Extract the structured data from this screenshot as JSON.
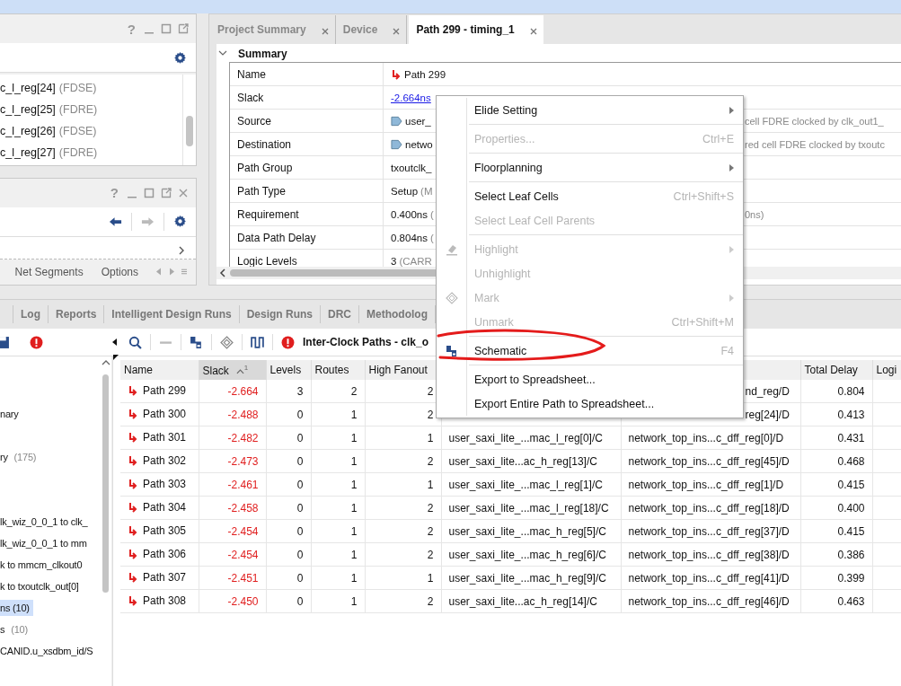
{
  "cells_panel": {
    "help": "?",
    "items": [
      {
        "name": "c_l_reg[24]",
        "type": "(FDSE)"
      },
      {
        "name": "c_l_reg[25]",
        "type": "(FDRE)"
      },
      {
        "name": "c_l_reg[26]",
        "type": "(FDSE)"
      },
      {
        "name": "c_l_reg[27]",
        "type": "(FDRE)"
      }
    ]
  },
  "nets_panel": {
    "help": "?",
    "tabs": [
      "Net Segments",
      "Options"
    ]
  },
  "editor_tabs": [
    {
      "label": "Project Summary",
      "selected": false
    },
    {
      "label": "Device",
      "selected": false
    },
    {
      "label": "Path 299 - timing_1",
      "selected": true
    }
  ],
  "summary": {
    "title": "Summary",
    "expanded": true,
    "rows": [
      {
        "label": "Name",
        "kind": "path",
        "value": "Path 299"
      },
      {
        "label": "Slack",
        "kind": "link",
        "value": "-2.664ns"
      },
      {
        "label": "Source",
        "kind": "port",
        "value": "user_",
        "tail": "cell FDRE clocked by clk_out1_"
      },
      {
        "label": "Destination",
        "kind": "port",
        "value": "netwo",
        "tail": "red cell FDRE clocked by txoutc"
      },
      {
        "label": "Path Group",
        "kind": "text",
        "value": "txoutclk_"
      },
      {
        "label": "Path Type",
        "kind": "text",
        "value": "Setup",
        "note": "(M"
      },
      {
        "label": "Requirement",
        "kind": "text",
        "value": "0.400ns",
        "note": "(",
        "tail": "0ns)"
      },
      {
        "label": "Data Path Delay",
        "kind": "text",
        "value": "0.804ns",
        "note": "("
      },
      {
        "label": "Logic Levels",
        "kind": "text",
        "value": "3",
        "note": "(CARR"
      }
    ]
  },
  "bottom_tabs": [
    "Log",
    "Reports",
    "Intelligent Design Runs",
    "Design Runs",
    "DRC",
    "Methodolog"
  ],
  "paths_toolbar": {
    "title": "Inter-Clock Paths - clk_o"
  },
  "tree": {
    "items": [
      {
        "text": "nary",
        "selected": false
      },
      {
        "text": "ry",
        "count": "(175)",
        "selected": false
      },
      {
        "text": "lk_wiz_0_0_1 to clk_",
        "selected": false
      },
      {
        "text": "lk_wiz_0_0_1 to mm",
        "selected": false
      },
      {
        "text": "k to mmcm_clkout0",
        "selected": false
      },
      {
        "text": "k to txoutclk_out[0]",
        "selected": false
      },
      {
        "text": "ns (10)",
        "selected": true
      },
      {
        "text": "s",
        "count": "(10)",
        "selected": false
      },
      {
        "text": "CANID.u_xsdbm_id/S",
        "selected": false
      }
    ]
  },
  "table": {
    "columns": [
      {
        "label": "Name",
        "sorted": false
      },
      {
        "label": "Slack",
        "sorted": true,
        "sort_order": "1"
      },
      {
        "label": "Levels",
        "sorted": false
      },
      {
        "label": "Routes",
        "sorted": false
      },
      {
        "label": "High Fanout",
        "sorted": false
      },
      {
        "label": "Total Delay",
        "sorted": false
      },
      {
        "label": "Logi",
        "sorted": false
      }
    ],
    "rows": [
      {
        "name": "Path 299",
        "slack": "-2.664",
        "levels": "3",
        "routes": "2",
        "fanout": "2",
        "to": "nd_reg/D",
        "delay": "0.804",
        "clipped": true
      },
      {
        "name": "Path 300",
        "slack": "-2.488",
        "levels": "0",
        "routes": "1",
        "fanout": "2",
        "to": "reg[24]/D",
        "delay": "0.413",
        "clipped": true
      },
      {
        "name": "Path 301",
        "slack": "-2.482",
        "levels": "0",
        "routes": "1",
        "fanout": "1",
        "from": "user_saxi_lite_...mac_l_reg[0]/C",
        "to": "network_top_ins...c_dff_reg[0]/D",
        "delay": "0.431",
        "clipped": false
      },
      {
        "name": "Path 302",
        "slack": "-2.473",
        "levels": "0",
        "routes": "1",
        "fanout": "2",
        "from": "user_saxi_lite...ac_h_reg[13]/C",
        "to": "network_top_ins...c_dff_reg[45]/D",
        "delay": "0.468",
        "clipped": false
      },
      {
        "name": "Path 303",
        "slack": "-2.461",
        "levels": "0",
        "routes": "1",
        "fanout": "1",
        "from": "user_saxi_lite_...mac_l_reg[1]/C",
        "to": "network_top_ins...c_dff_reg[1]/D",
        "delay": "0.415",
        "clipped": false
      },
      {
        "name": "Path 304",
        "slack": "-2.458",
        "levels": "0",
        "routes": "1",
        "fanout": "2",
        "from": "user_saxi_lite_...mac_l_reg[18]/C",
        "to": "network_top_ins...c_dff_reg[18]/D",
        "delay": "0.400",
        "clipped": false
      },
      {
        "name": "Path 305",
        "slack": "-2.454",
        "levels": "0",
        "routes": "1",
        "fanout": "2",
        "from": "user_saxi_lite_...mac_h_reg[5]/C",
        "to": "network_top_ins...c_dff_reg[37]/D",
        "delay": "0.415",
        "clipped": false
      },
      {
        "name": "Path 306",
        "slack": "-2.454",
        "levels": "0",
        "routes": "1",
        "fanout": "2",
        "from": "user_saxi_lite_...mac_h_reg[6]/C",
        "to": "network_top_ins...c_dff_reg[38]/D",
        "delay": "0.386",
        "clipped": false
      },
      {
        "name": "Path 307",
        "slack": "-2.451",
        "levels": "0",
        "routes": "1",
        "fanout": "1",
        "from": "user_saxi_lite_...mac_h_reg[9]/C",
        "to": "network_top_ins...c_dff_reg[41]/D",
        "delay": "0.399",
        "clipped": false
      },
      {
        "name": "Path 308",
        "slack": "-2.450",
        "levels": "0",
        "routes": "1",
        "fanout": "2",
        "from": "user_saxi_lite...ac_h_reg[14]/C",
        "to": "network_top_ins...c_dff_reg[46]/D",
        "delay": "0.463",
        "clipped": false
      }
    ]
  },
  "context_menu": {
    "items": [
      {
        "kind": "item",
        "label": "Elide Setting",
        "disabled": false,
        "submenu": true
      },
      {
        "kind": "separator"
      },
      {
        "kind": "item",
        "label": "Properties...",
        "shortcut": "Ctrl+E",
        "disabled": true,
        "submenu": false
      },
      {
        "kind": "separator"
      },
      {
        "kind": "item",
        "label": "Floorplanning",
        "disabled": false,
        "submenu": true
      },
      {
        "kind": "separator"
      },
      {
        "kind": "item",
        "label": "Select Leaf Cells",
        "shortcut": "Ctrl+Shift+S",
        "disabled": false,
        "submenu": false
      },
      {
        "kind": "item",
        "label": "Select Leaf Cell Parents",
        "disabled": true,
        "submenu": false
      },
      {
        "kind": "separator"
      },
      {
        "kind": "item",
        "label": "Highlight",
        "disabled": true,
        "submenu": true
      },
      {
        "kind": "item",
        "label": "Unhighlight",
        "disabled": true,
        "submenu": false
      },
      {
        "kind": "item",
        "label": "Mark",
        "disabled": true,
        "submenu": true
      },
      {
        "kind": "item",
        "label": "Unmark",
        "shortcut": "Ctrl+Shift+M",
        "disabled": true,
        "submenu": false
      },
      {
        "kind": "separator"
      },
      {
        "kind": "item",
        "label": "Schematic",
        "shortcut": "F4",
        "disabled": false,
        "submenu": false
      },
      {
        "kind": "separator"
      },
      {
        "kind": "item",
        "label": "Export to Spreadsheet...",
        "disabled": false,
        "submenu": false
      },
      {
        "kind": "item",
        "label": "Export Entire Path to Spreadsheet...",
        "disabled": false,
        "submenu": false
      }
    ]
  }
}
